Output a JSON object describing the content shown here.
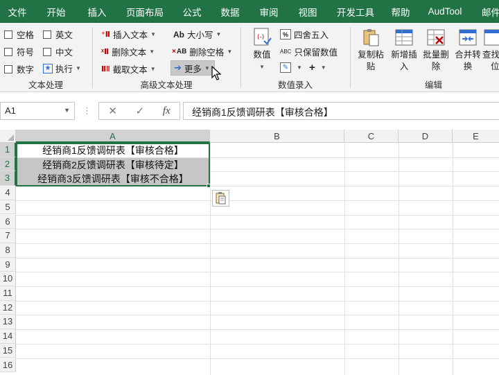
{
  "menu": [
    "文件",
    "开始",
    "插入",
    "页面布局",
    "公式",
    "数据",
    "审阅",
    "视图",
    "开发工具",
    "帮助",
    "AudTool",
    "邮件"
  ],
  "ribbon": {
    "text_group": {
      "items": [
        "空格",
        "英文",
        "符号",
        "中文",
        "数字",
        "执行"
      ],
      "label": "文本处理"
    },
    "adv_group": {
      "insert_text": "插入文本",
      "delete_text": "删除文本",
      "extract_text": "截取文本",
      "case": "大小写",
      "delete_space": "删除空格",
      "more": "更多",
      "case_icon_text": "Ab",
      "space_icon_text": "AB",
      "label": "高级文本处理"
    },
    "num_group": {
      "value_label": "数值",
      "round_label": "四舍五入",
      "keep_value_label": "只保留数值",
      "abc_icon_text": "ABC",
      "percent_icon_text": "%",
      "label": "数值录入"
    },
    "edit_group": {
      "copy_paste": [
        "复制粘",
        "贴"
      ],
      "add_insert": [
        "新增插",
        "入"
      ],
      "batch_delete": [
        "批量删",
        "除"
      ],
      "merge_convert": [
        "合并转",
        "换"
      ],
      "lookup": [
        "查找",
        "位"
      ],
      "label": "编辑"
    }
  },
  "formula_bar": {
    "name_box": "A1",
    "formula": "经销商1反馈调研表【审核合格】",
    "cancel_symbol": "✕",
    "enter_symbol": "✓",
    "fx_symbol": "fx"
  },
  "sheet": {
    "columns": [
      "A",
      "B",
      "C",
      "D",
      "E"
    ],
    "rows": [
      "1",
      "2",
      "3",
      "4",
      "5",
      "6",
      "7",
      "8",
      "9",
      "10",
      "11",
      "12",
      "13",
      "14",
      "15",
      "16"
    ],
    "cells": [
      "经销商1反馈调研表【审核合格】",
      "经销商2反馈调研表【审核待定】",
      "经销商3反馈调研表【审核不合格】"
    ]
  },
  "colors": {
    "accent": "#217346",
    "ribbon_bg": "#f3f3f3",
    "selection_shade": "#c6c6c6"
  }
}
